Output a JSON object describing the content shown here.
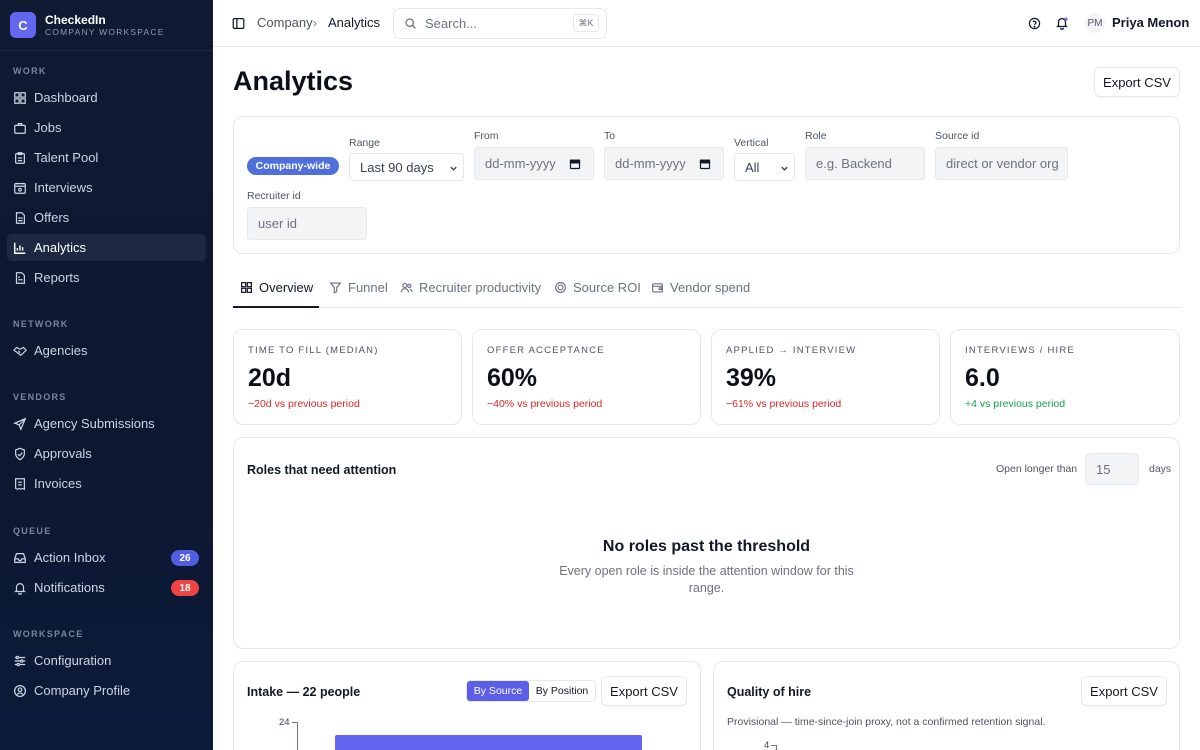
{
  "brand": {
    "initial": "C",
    "name": "CheckedIn",
    "subtitle": "COMPANY WORKSPACE"
  },
  "sidebar": {
    "sections": [
      {
        "label": "WORK"
      },
      {
        "label": "NETWORK"
      },
      {
        "label": "VENDORS"
      },
      {
        "label": "QUEUE"
      },
      {
        "label": "WORKSPACE"
      }
    ],
    "items": [
      {
        "label": "Dashboard",
        "icon": "dashboard-icon"
      },
      {
        "label": "Jobs",
        "icon": "briefcase-icon"
      },
      {
        "label": "Talent Pool",
        "icon": "clipboard-icon"
      },
      {
        "label": "Interviews",
        "icon": "calendar-icon"
      },
      {
        "label": "Offers",
        "icon": "document-icon"
      },
      {
        "label": "Analytics",
        "icon": "bar-chart-icon",
        "active": true
      },
      {
        "label": "Reports",
        "icon": "report-icon"
      },
      {
        "label": "Agencies",
        "icon": "handshake-icon"
      },
      {
        "label": "Agency Submissions",
        "icon": "send-icon"
      },
      {
        "label": "Approvals",
        "icon": "shield-check-icon"
      },
      {
        "label": "Invoices",
        "icon": "receipt-icon"
      },
      {
        "label": "Action Inbox",
        "icon": "inbox-icon",
        "badge": "26",
        "badge_color": "#4f5fe0"
      },
      {
        "label": "Notifications",
        "icon": "bell-icon",
        "badge": "18",
        "badge_color": "#ef4444"
      },
      {
        "label": "Configuration",
        "icon": "sliders-icon"
      },
      {
        "label": "Company Profile",
        "icon": "user-circle-icon"
      }
    ]
  },
  "topbar": {
    "breadcrumb": [
      "Company",
      "Analytics"
    ],
    "search_placeholder": "Search...",
    "search_shortcut": "⌘K",
    "user_initials": "PM",
    "user_name": "Priya Menon"
  },
  "page": {
    "title": "Analytics",
    "export_label": "Export CSV"
  },
  "filters": {
    "scope_chip": "Company-wide",
    "range_label": "Range",
    "range_value": "Last 90 days",
    "from_label": "From",
    "from_placeholder": "dd-mm-yyyy",
    "to_label": "To",
    "to_placeholder": "dd-mm-yyyy",
    "vertical_label": "Vertical",
    "vertical_value": "All",
    "role_label": "Role",
    "role_placeholder": "e.g. Backend",
    "source_label": "Source id",
    "source_placeholder": "direct or vendor org",
    "recruiter_label": "Recruiter id",
    "recruiter_placeholder": "user id"
  },
  "tabs": [
    {
      "label": "Overview",
      "icon": "grid-icon",
      "active": true
    },
    {
      "label": "Funnel",
      "icon": "filter-icon"
    },
    {
      "label": "Recruiter productivity",
      "icon": "users-icon"
    },
    {
      "label": "Source ROI",
      "icon": "coins-icon"
    },
    {
      "label": "Vendor spend",
      "icon": "wallet-icon"
    }
  ],
  "kpis": [
    {
      "label": "TIME TO FILL (MEDIAN)",
      "value": "20d",
      "delta": "−20d vs previous period",
      "trend": "negative"
    },
    {
      "label": "OFFER ACCEPTANCE",
      "value": "60%",
      "delta": "−40% vs previous period",
      "trend": "negative"
    },
    {
      "label": "APPLIED → INTERVIEW",
      "value": "39%",
      "delta": "−61% vs previous period",
      "trend": "negative"
    },
    {
      "label": "INTERVIEWS / HIRE",
      "value": "6.0",
      "delta": "+4 vs previous period",
      "trend": "positive"
    }
  ],
  "attention": {
    "title": "Roles that need attention",
    "threshold_label": "Open longer than",
    "threshold_value": "15",
    "threshold_unit": "days",
    "empty_title": "No roles past the threshold",
    "empty_body": "Every open role is inside the attention window for this range."
  },
  "intake": {
    "title": "Intake — 22 people",
    "toggle": [
      "By Source",
      "By Position"
    ],
    "export_label": "Export CSV",
    "chart_data": {
      "type": "bar",
      "y_tick_visible": "24",
      "bar_value": 22
    }
  },
  "quality": {
    "title": "Quality of hire",
    "export_label": "Export CSV",
    "note": "Provisional — time-since-join proxy, not a confirmed retention signal.",
    "chart_data": {
      "type": "bar",
      "y_tick_visible": "4"
    }
  },
  "colors": {
    "accent": "#6366f1",
    "negative": "#dc2626",
    "positive": "#16a34a",
    "sidebar_bg": "#0f1a33"
  }
}
